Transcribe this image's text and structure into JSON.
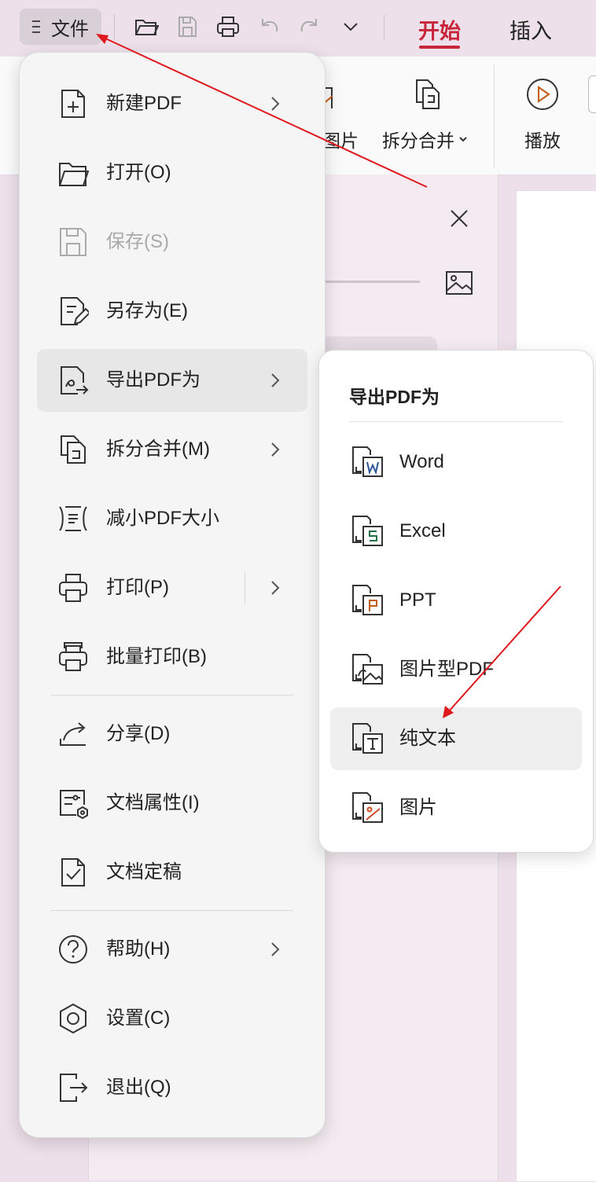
{
  "toolbar": {
    "file_label": "文件",
    "tabs": [
      "开始",
      "插入"
    ],
    "active_tab_color": "#c9253a"
  },
  "ribbon": {
    "image_label": "图片",
    "split_merge_label": "拆分合并",
    "play_label": "播放"
  },
  "file_menu": {
    "items": [
      {
        "label": "新建PDF",
        "icon": "new-pdf-icon",
        "submenu": true
      },
      {
        "label": "打开(O)",
        "icon": "open-folder-icon"
      },
      {
        "label": "保存(S)",
        "icon": "save-icon",
        "disabled": true
      },
      {
        "label": "另存为(E)",
        "icon": "save-as-icon"
      },
      {
        "label": "导出PDF为",
        "icon": "export-pdf-icon",
        "submenu": true,
        "highlighted": true
      },
      {
        "label": "拆分合并(M)",
        "icon": "split-merge-icon",
        "submenu": true
      },
      {
        "label": "减小PDF大小",
        "icon": "compress-icon"
      },
      {
        "label": "打印(P)",
        "icon": "print-icon",
        "submenu": true
      },
      {
        "label": "批量打印(B)",
        "icon": "batch-print-icon"
      },
      {
        "label": "分享(D)",
        "icon": "share-icon"
      },
      {
        "label": "文档属性(I)",
        "icon": "doc-properties-icon"
      },
      {
        "label": "文档定稿",
        "icon": "finalize-icon"
      },
      {
        "label": "帮助(H)",
        "icon": "help-icon",
        "submenu": true
      },
      {
        "label": "设置(C)",
        "icon": "settings-icon"
      },
      {
        "label": "退出(Q)",
        "icon": "exit-icon"
      }
    ]
  },
  "export_submenu": {
    "title": "导出PDF为",
    "items": [
      {
        "label": "Word",
        "icon": "word-icon",
        "color": "#2b5797"
      },
      {
        "label": "Excel",
        "icon": "excel-icon",
        "color": "#1e7145"
      },
      {
        "label": "PPT",
        "icon": "ppt-icon",
        "color": "#c55a11"
      },
      {
        "label": "图片型PDF",
        "icon": "image-pdf-icon"
      },
      {
        "label": "纯文本",
        "icon": "plain-text-icon",
        "highlighted": true
      },
      {
        "label": "图片",
        "icon": "image-icon",
        "color": "#d04a23"
      }
    ]
  },
  "annotation_color": "#e0191e"
}
